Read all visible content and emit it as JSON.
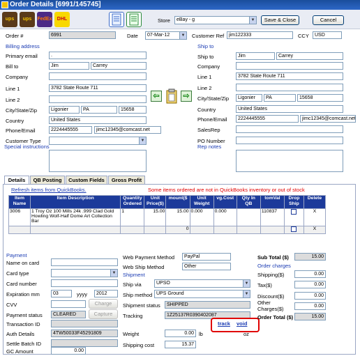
{
  "window": {
    "title": "Order Details  [6991/145745]"
  },
  "toolbar": {
    "icons": [
      "ups-icon",
      "ups-icon-2",
      "fedex-icon",
      "dhl-icon",
      "document-icon",
      "document-list-icon"
    ],
    "ups1": "ups",
    "ups2": "ups",
    "fedex": "FedEx",
    "dhl": "DHL",
    "store_label": "Store",
    "store_value": "eBay - g",
    "save_close": "Save & Close",
    "cancel": "Cancel"
  },
  "header": {
    "order_label": "Order #",
    "order_value": "6991",
    "date_label": "Date",
    "date_value": "07-Mar-12",
    "custref_label": "Customer Ref",
    "custref_value": "jim122333",
    "ccy_label": "CCY",
    "ccy_value": "USD"
  },
  "billing": {
    "section": "Billing address",
    "primary_email_label": "Primary email",
    "primary_email_value": ".",
    "bill_to_label": "Bill to",
    "first": "Jim",
    "last": "Carrey",
    "company_label": "Company",
    "company_value": "",
    "line1_label": "Line 1",
    "line1_value": "3782 State Route 711",
    "line2_label": "Line 2",
    "line2_value": "",
    "city_label": "City/State/Zip",
    "city": "Ligonier",
    "state": "PA",
    "zip": "15658",
    "country_label": "Country",
    "country": "United States",
    "phone_label": "Phone/Email",
    "phone": "2224445555",
    "email": "jimc12345@comcast.net",
    "ctype_label": "Customer Type",
    "ctype_value": "",
    "special_label": "Special instructions"
  },
  "shipping": {
    "section": "Ship to",
    "ship_to_label": "Ship to",
    "first": "Jim",
    "last": "Carrey",
    "company_label": "Company",
    "company_value": "",
    "line1_label": "Line 1",
    "line1_value": "3782 State Route 711",
    "line2_label": "Line 2",
    "line2_value": "",
    "city_label": "City/State/Zip",
    "city": "Ligonier",
    "state": "PA",
    "zip": "15658",
    "country_label": "Country",
    "country": "United States",
    "phone_label": "Phone/Email",
    "phone": "2224445555",
    "email": "jimc12345@comcast.net",
    "salesrep_label": "SalesRep",
    "salesrep_value": "",
    "po_label": "PO Number",
    "po_value": "",
    "rep_notes_label": "Rep notes"
  },
  "tabs": [
    "Details",
    "QB Posting",
    "Custom Fields",
    "Gross Profit"
  ],
  "details": {
    "refresh_link": "Refresh items from QuickBooks.",
    "warning": "Some items ordered are not in QuickBooks inventory or out of stock",
    "columns": [
      "Item Name",
      "Item Description",
      "Quantity Ordered",
      "Unit Price($)",
      "Amount($)",
      "Unit Weight",
      "Avg.Cost",
      "Qty In QB",
      "CustomVal",
      "Drop Ship",
      "Delete"
    ],
    "col_display": [
      "Item\nName",
      "Item Description",
      "Quantity\nOrdered",
      "Unit\nPrice($)",
      "mount($",
      "Unit\nWeight",
      "vg.Cost",
      "Qty In\nQB",
      "tomVal",
      "Drop\nShip",
      "Delete"
    ],
    "row": {
      "item_name": "3006",
      "description": "1 Troy Oz 100 Mills 24k .999 Clad Gold Howling Wolf-Half Dome Art Collection Bar",
      "qty": "1",
      "unit_price": "15.00",
      "amount": "15.00",
      "weight": "0.000",
      "avg_cost": "0.000",
      "qty_qb": "",
      "custom": "110837",
      "delete": "X"
    },
    "total_row": {
      "amount": "0",
      "delete": "X"
    }
  },
  "payment": {
    "section": "Payment",
    "name_label": "Name on card",
    "name_value": "",
    "cardtype_label": "Card type",
    "cardtype_value": "",
    "cardnum_label": "Card number",
    "cardnum_value": "",
    "exp_label": "Expiration mm",
    "exp_mm": "03",
    "yyyy_label": "yyyy",
    "exp_yyyy": "2012",
    "cvv_label": "CVV",
    "cvv_value": "",
    "charge": "Charge",
    "status_label": "Payment status",
    "status_value": "CLEARED",
    "capture": "Capture",
    "txn_label": "Transaction ID",
    "txn_value": "",
    "auth_label": "Auth Details",
    "auth_value": "4TW50033F45291809",
    "settle_label": "Settle Batch ID",
    "settle_value": "",
    "gc_label": "GC Amount",
    "gc_value": "0.00"
  },
  "shipment": {
    "web_pay_label": "Web Payment Method",
    "web_pay_value": "PayPal",
    "web_ship_label": "Web Ship Method",
    "web_ship_value": "Other",
    "section": "Shipment",
    "via_label": "Ship via",
    "via_value": "UPSO",
    "method_label": "Ship method",
    "method_value": "UPS Ground",
    "status_label": "Shipment status",
    "status_value": "SHIPPED",
    "tracking_label": "Tracking",
    "tracking_value": "1Z25137R0390402087",
    "track_link": "track",
    "void_link": "void",
    "weight_label": "Weight",
    "weight_value": "0.00",
    "lb": "lb",
    "weight_oz": "0.00",
    "oz": "oz",
    "cost_label": "Shipping cost",
    "cost_value": "15.37"
  },
  "totals": {
    "subtotal_label": "Sub Total ($)",
    "subtotal_value": "15.00",
    "charges_section": "Order charges",
    "shipping_label": "Shipping($)",
    "shipping_value": "0.00",
    "tax_label": "Tax($)",
    "tax_value": "0.00",
    "discount_label": "Discount($)",
    "discount_value": "0.00",
    "other_label": "Other Charges($)",
    "other_value": "0.00",
    "total_label": "Order Total ($)",
    "total_value": "15.00"
  },
  "colors": {
    "title_bar": "#1a4d9c",
    "section_blue": "#1a3bb3",
    "warning_red": "#e00000",
    "grid_header": "#1c3a9a",
    "highlight_red": "#e00000"
  }
}
